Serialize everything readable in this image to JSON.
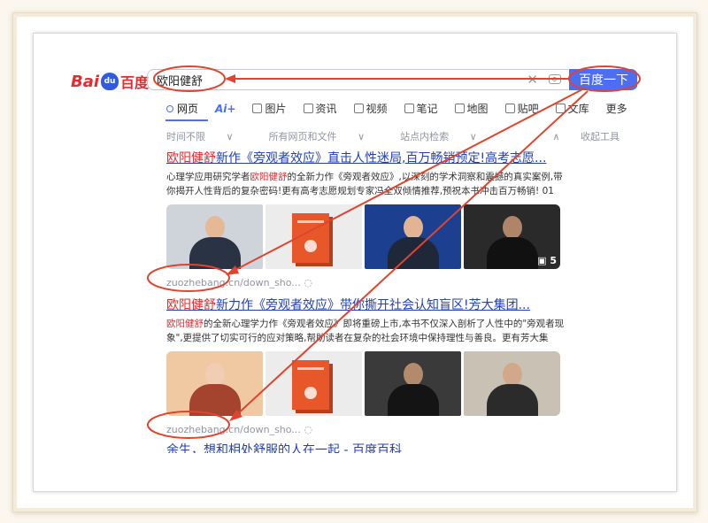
{
  "logo": {
    "bai": "Bai",
    "du": "du",
    "text": "百度"
  },
  "search": {
    "query": "欧阳健舒",
    "clear": "✕",
    "button": "百度一下"
  },
  "tabs": [
    {
      "label": "网页",
      "active": true
    },
    {
      "label": "Ai+",
      "active": false
    },
    {
      "label": "图片",
      "active": false
    },
    {
      "label": "资讯",
      "active": false
    },
    {
      "label": "视频",
      "active": false
    },
    {
      "label": "笔记",
      "active": false
    },
    {
      "label": "地图",
      "active": false
    },
    {
      "label": "贴吧",
      "active": false
    },
    {
      "label": "文库",
      "active": false
    },
    {
      "label": "更多",
      "active": false
    }
  ],
  "filters": {
    "time": "时间不限",
    "type": "所有网页和文件",
    "site": "站点内检索",
    "collapse": "收起工具"
  },
  "results": [
    {
      "title_hl": "欧阳健舒",
      "title_rest": "新作《旁观者效应》直击人性迷局,百万畅销预定!高考志愿...",
      "desc_pre": "心理学应用研究学者",
      "desc_hl": "欧阳健舒",
      "desc_post": "的全新力作《旁观者效应》,以深刻的学术洞察和震撼的真实案例,带你揭开人性背后的复杂密码!更有高考志愿规划专家冯全双倾情推荐,预祝本书冲击百万畅销! 01 ...",
      "badge": "5",
      "source": "zuozhebang.cn/down_sho..."
    },
    {
      "title_hl": "欧阳健舒",
      "title_rest": "新力作《旁观者效应》带你撕开社会认知盲区!芳大集团...",
      "desc_pre": "",
      "desc_hl": "欧阳健舒",
      "desc_post": "的全新心理学力作《旁观者效应》即将重磅上市,本书不仅深入剖析了人性中的\"旁观者现象\",更提供了切实可行的应对策略,帮助读者在复杂的社会环境中保持理性与善良。更有芳大集团...",
      "badge": "",
      "source": "zuozhebang.cn/down_sho..."
    }
  ],
  "next_result_title": "余生，想和相处舒服的人在一起 - 百度百科",
  "colors": {
    "accent": "#4e6ef2",
    "highlight": "#e8292e",
    "annotation": "#e0442e"
  }
}
